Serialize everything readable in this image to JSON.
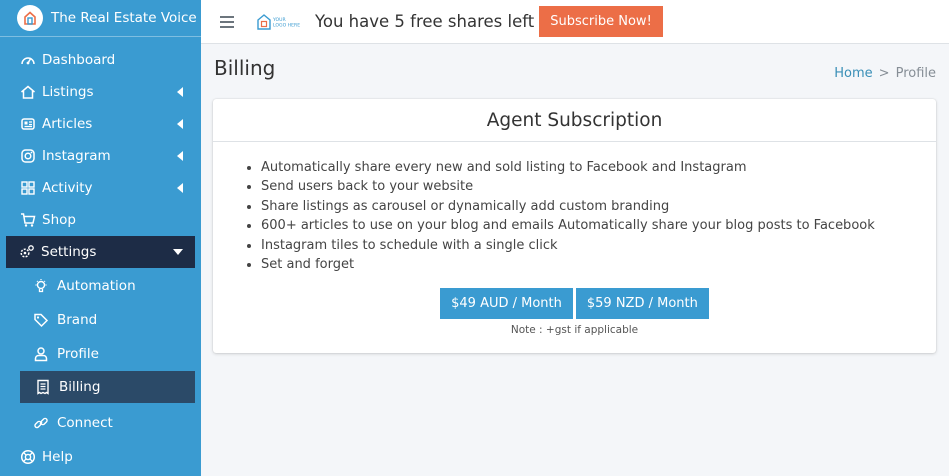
{
  "brand": {
    "name": "The Real Estate Voice"
  },
  "sidebar": {
    "items": [
      {
        "label": "Dashboard",
        "icon": "dashboard-icon"
      },
      {
        "label": "Listings",
        "icon": "house-icon"
      },
      {
        "label": "Articles",
        "icon": "newspaper-icon"
      },
      {
        "label": "Instagram",
        "icon": "instagram-icon"
      },
      {
        "label": "Activity",
        "icon": "grid-icon"
      },
      {
        "label": "Shop",
        "icon": "cart-icon"
      },
      {
        "label": "Settings",
        "icon": "cogs-icon"
      },
      {
        "label": "Automation",
        "icon": "lightbulb-icon"
      },
      {
        "label": "Brand",
        "icon": "tag-icon"
      },
      {
        "label": "Profile",
        "icon": "user-icon"
      },
      {
        "label": "Billing",
        "icon": "receipt-icon"
      },
      {
        "label": "Connect",
        "icon": "link-icon"
      },
      {
        "label": "Help",
        "icon": "help-icon"
      }
    ]
  },
  "topbar": {
    "logo_text": "YOUR LOGO HERE",
    "shares_message": "You have 5 free shares left",
    "subscribe_label": "Subscribe Now!"
  },
  "page": {
    "title": "Billing",
    "breadcrumb": {
      "home": "Home",
      "separator": ">",
      "current": "Profile"
    }
  },
  "card": {
    "title": "Agent Subscription",
    "features": [
      "Automatically share every new and sold listing to Facebook and Instagram",
      "Send users back to your website",
      "Share listings as carousel or dynamically add custom branding",
      "600+ articles to use on your blog and emails Automatically share your blog posts to Facebook",
      "Instagram tiles to schedule with a single click",
      "Set and forget"
    ],
    "price_aud": "$49 AUD / Month",
    "price_nzd": "$59 NZD / Month",
    "note": "Note : +gst if applicable"
  },
  "colors": {
    "sidebar": "#3a9bd1",
    "active_item": "#1d2c46",
    "subscribe": "#ec6e47"
  }
}
